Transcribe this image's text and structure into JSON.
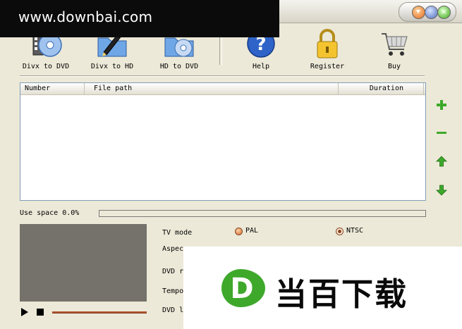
{
  "watermark": {
    "site": "www.downbai.com",
    "brand_text": "当百下载",
    "brand_letter": "D"
  },
  "window": {
    "close_glyph": "×"
  },
  "toolbar": {
    "items": [
      {
        "label": "Divx to DVD",
        "icon": "film-disc-icon"
      },
      {
        "label": "Divx to HD",
        "icon": "folder-pen-icon"
      },
      {
        "label": "HD to DVD",
        "icon": "folder-disc-icon"
      },
      {
        "label": "Help",
        "icon": "help-icon"
      },
      {
        "label": "Register",
        "icon": "lock-icon"
      },
      {
        "label": "Buy",
        "icon": "cart-icon"
      }
    ]
  },
  "file_list": {
    "columns": [
      "Number",
      "File path",
      "Duration"
    ],
    "rows": []
  },
  "side_buttons": [
    "add-icon",
    "remove-icon",
    "move-up-icon",
    "move-down-icon"
  ],
  "usage": {
    "label": "Use space 0.0%",
    "value": 0.0
  },
  "settings": {
    "tv_mode_label": "TV mode",
    "tv_mode_options": [
      "PAL",
      "NTSC"
    ],
    "tv_mode_selected": "NTSC",
    "aspect_label": "Aspec",
    "dvd_r_label": "DVD r",
    "tempo_label": "Tempo",
    "dvd_l_label": "DVD l"
  },
  "colors": {
    "accent_green": "#3ea82b",
    "progress": "#3d8fe0",
    "radio": "#d0692c"
  }
}
